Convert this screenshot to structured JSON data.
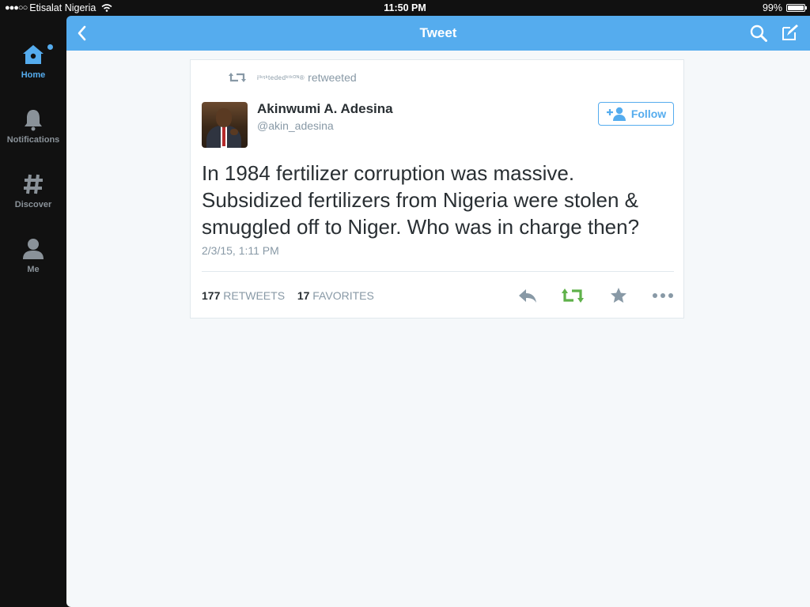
{
  "status_bar": {
    "signal": "●●●○○",
    "carrier": "Etisalat Nigeria",
    "time": "11:50 PM",
    "battery": "99%",
    "battery_level": 0.99
  },
  "sidebar": {
    "items": [
      {
        "label": "Home",
        "icon": "home-icon",
        "active": true
      },
      {
        "label": "Notifications",
        "icon": "bell-icon",
        "active": false
      },
      {
        "label": "Discover",
        "icon": "hashtag-icon",
        "active": false
      },
      {
        "label": "Me",
        "icon": "person-icon",
        "active": false
      }
    ]
  },
  "navbar": {
    "title": "Tweet",
    "color": "#55acee"
  },
  "tweet": {
    "retweeted_by": "iˡᵏᵑᵏtededᵏᵗᵏᴼᴺ®",
    "retweeted_label": "retweeted",
    "author_name": "Akinwumi A. Adesina",
    "author_handle": "@akin_adesina",
    "follow_label": "Follow",
    "text": "In 1984 fertilizer corruption was massive. Subsidized fertilizers from Nigeria were stolen & smuggled off to Niger. Who was in charge then?",
    "timestamp": "2/3/15, 1:11 PM",
    "retweets_count": "177",
    "retweets_label": "RETWEETS",
    "favorites_count": "17",
    "favorites_label": "FAVORITES"
  },
  "colors": {
    "accent": "#55acee",
    "retweet_green": "#5fb14a",
    "muted": "#8899a6",
    "text": "#292f33"
  }
}
